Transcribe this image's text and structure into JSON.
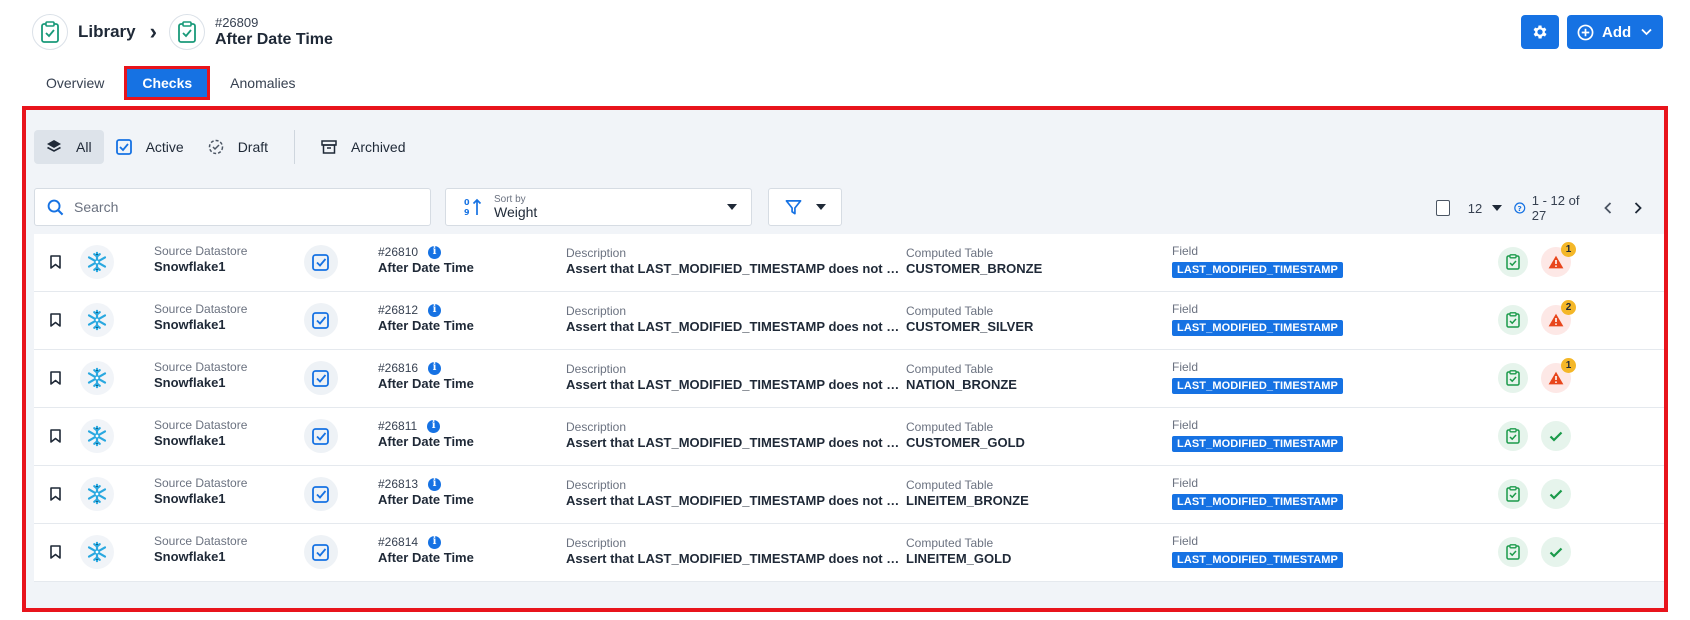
{
  "breadcrumb": {
    "library_label": "Library",
    "check_id": "#26809",
    "check_title": "After Date Time"
  },
  "toolbar": {
    "add_label": "Add"
  },
  "tabs": [
    {
      "label": "Overview"
    },
    {
      "label": "Checks"
    },
    {
      "label": "Anomalies"
    }
  ],
  "status_filters": [
    {
      "label": "All"
    },
    {
      "label": "Active"
    },
    {
      "label": "Draft"
    },
    {
      "label": "Archived"
    }
  ],
  "search": {
    "placeholder": "Search"
  },
  "sort": {
    "caption": "Sort by",
    "value": "Weight"
  },
  "pagination": {
    "per_page": "12",
    "range": "1 - 12 of 27"
  },
  "row_labels": {
    "source": "Source Datastore",
    "description": "Description",
    "table": "Computed Table",
    "field": "Field"
  },
  "rows": [
    {
      "source": "Snowflake1",
      "id": "#26810",
      "title": "After Date Time",
      "description": "Assert that LAST_MODIFIED_TIMESTAMP does not exc...",
      "table": "CUSTOMER_BRONZE",
      "field": "LAST_MODIFIED_TIMESTAMP",
      "anomalies": "1"
    },
    {
      "source": "Snowflake1",
      "id": "#26812",
      "title": "After Date Time",
      "description": "Assert that LAST_MODIFIED_TIMESTAMP does not exc...",
      "table": "CUSTOMER_SILVER",
      "field": "LAST_MODIFIED_TIMESTAMP",
      "anomalies": "2"
    },
    {
      "source": "Snowflake1",
      "id": "#26816",
      "title": "After Date Time",
      "description": "Assert that LAST_MODIFIED_TIMESTAMP does not exc...",
      "table": "NATION_BRONZE",
      "field": "LAST_MODIFIED_TIMESTAMP",
      "anomalies": "1"
    },
    {
      "source": "Snowflake1",
      "id": "#26811",
      "title": "After Date Time",
      "description": "Assert that LAST_MODIFIED_TIMESTAMP does not exc...",
      "table": "CUSTOMER_GOLD",
      "field": "LAST_MODIFIED_TIMESTAMP",
      "anomalies": null
    },
    {
      "source": "Snowflake1",
      "id": "#26813",
      "title": "After Date Time",
      "description": "Assert that LAST_MODIFIED_TIMESTAMP does not exc...",
      "table": "LINEITEM_BRONZE",
      "field": "LAST_MODIFIED_TIMESTAMP",
      "anomalies": null
    },
    {
      "source": "Snowflake1",
      "id": "#26814",
      "title": "After Date Time",
      "description": "Assert that LAST_MODIFIED_TIMESTAMP does not exc...",
      "table": "LINEITEM_GOLD",
      "field": "LAST_MODIFIED_TIMESTAMP",
      "anomalies": null
    }
  ],
  "colors": {
    "primary": "#1672e3",
    "highlight": "#e8141c",
    "panel_bg": "#f1f4f8",
    "badge": "#f4b728",
    "success": "#1a9a4a",
    "warning": "#e8461c"
  }
}
